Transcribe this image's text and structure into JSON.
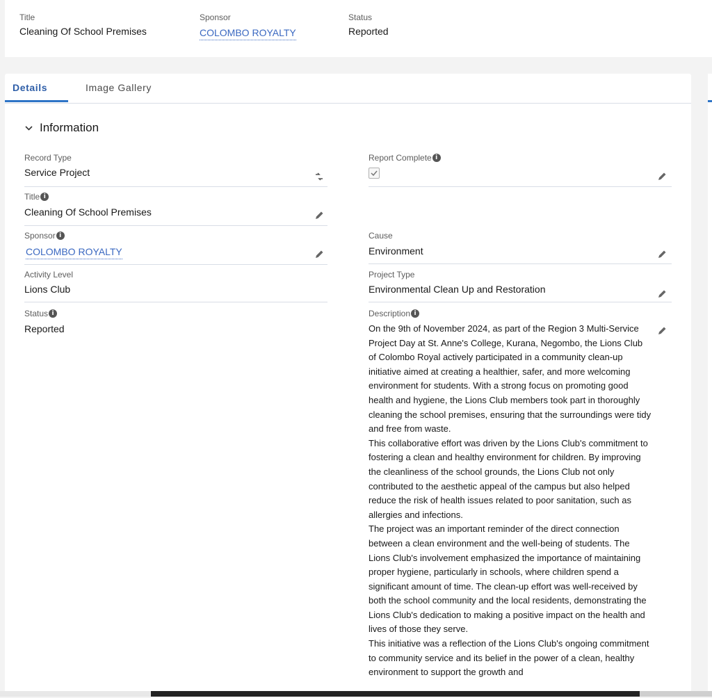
{
  "highlights": {
    "title_label": "Title",
    "title_value": "Cleaning Of School Premises",
    "sponsor_label": "Sponsor",
    "sponsor_value": "COLOMBO ROYALTY",
    "status_label": "Status",
    "status_value": "Reported"
  },
  "tabs": [
    {
      "label": "Details"
    },
    {
      "label": "Image Gallery"
    }
  ],
  "section": {
    "title": "Information"
  },
  "fields": {
    "record_type": {
      "label": "Record Type",
      "value": "Service Project"
    },
    "title": {
      "label": "Title",
      "value": "Cleaning Of School Premises"
    },
    "sponsor": {
      "label": "Sponsor",
      "value": "COLOMBO ROYALTY"
    },
    "activity_level": {
      "label": "Activity Level",
      "value": "Lions Club"
    },
    "status": {
      "label": "Status",
      "value": "Reported"
    },
    "report_complete": {
      "label": "Report Complete",
      "checked": true
    },
    "cause": {
      "label": "Cause",
      "value": "Environment"
    },
    "project_type": {
      "label": "Project Type",
      "value": "Environmental Clean Up and Restoration"
    },
    "description": {
      "label": "Description",
      "paragraphs": [
        "On the 9th of November 2024, as part of the Region 3 Multi-Service Project Day at St. Anne's College, Kurana, Negombo, the Lions Club of Colombo Royal actively participated in a community clean-up initiative aimed at creating a healthier, safer, and more welcoming environment for students. With a strong focus on promoting good health and hygiene, the Lions Club members took part in thoroughly cleaning the school premises, ensuring that the surroundings were tidy and free from waste.",
        "This collaborative effort was driven by the Lions Club's commitment to fostering a clean and healthy environment for children. By improving the cleanliness of the school grounds, the Lions Club not only contributed to the aesthetic appeal of the campus but also helped reduce the risk of health issues related to poor sanitation, such as allergies and infections.",
        "The project was an important reminder of the direct connection between a clean environment and the well-being of students. The Lions Club's involvement emphasized the importance of maintaining proper hygiene, particularly in schools, where children spend a significant amount of time. The clean-up effort was well-received by both the school community and the local residents, demonstrating the Lions Club's dedication to making a positive impact on the health and lives of those they serve.",
        "This initiative was a reflection of the Lions Club's ongoing commitment to community service and its belief in the power of a clean, healthy environment to support the growth and"
      ]
    }
  },
  "colors": {
    "link": "#3a68c1",
    "tab_accent": "#2e74c6",
    "page_bg": "#f3f3f3",
    "card_bg": "#ffffff"
  }
}
